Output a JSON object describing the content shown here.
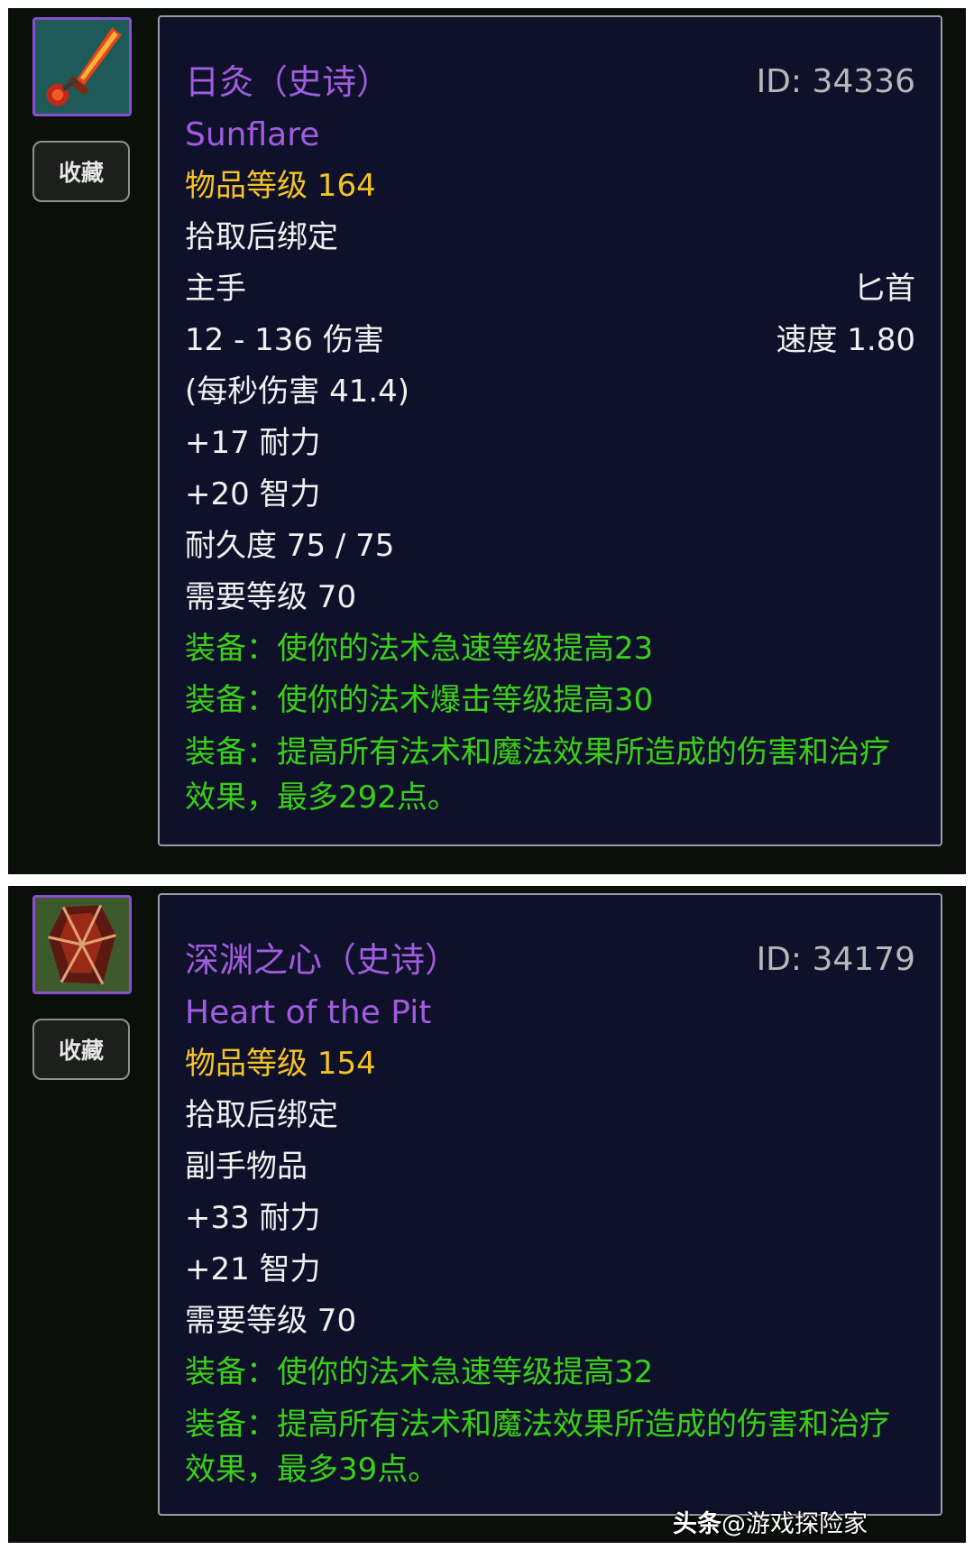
{
  "items": [
    {
      "name_cn": "日灸（史诗）",
      "name_en": "Sunflare",
      "id": "ID: 34336",
      "item_level": "物品等级 164",
      "bind": "拾取后绑定",
      "slot": "主手",
      "weapon_type": "匕首",
      "damage": "12 - 136 伤害",
      "speed": "速度 1.80",
      "dps": "(每秒伤害 41.4)",
      "stats": [
        "+17 耐力",
        "+20 智力"
      ],
      "durability": "耐久度 75 / 75",
      "req_level": "需要等级 70",
      "effects": [
        "装备：使你的法术急速等级提高23",
        "装备：使你的法术爆击等级提高30",
        "装备：提高所有法术和魔法效果所造成的伤害和治疗效果，最多292点。"
      ],
      "fav_label": "收藏",
      "icon": "dagger-icon"
    },
    {
      "name_cn": "深渊之心（史诗）",
      "name_en": "Heart of the Pit",
      "id": "ID: 34179",
      "item_level": "物品等级 154",
      "bind": "拾取后绑定",
      "slot": "副手物品",
      "stats": [
        "+33 耐力",
        "+21 智力"
      ],
      "req_level": "需要等级 70",
      "effects": [
        "装备：使你的法术急速等级提高32",
        "装备：提高所有法术和魔法效果所造成的伤害和治疗效果，最多39点。"
      ],
      "fav_label": "收藏",
      "icon": "crystal-icon"
    }
  ],
  "watermark": {
    "brand": "头条",
    "account": "@游戏探险家"
  },
  "colors": {
    "name": "#a15ce0",
    "item_level": "#f5c326",
    "effect": "#3ad017",
    "tooltip_bg": "#0e1129"
  }
}
